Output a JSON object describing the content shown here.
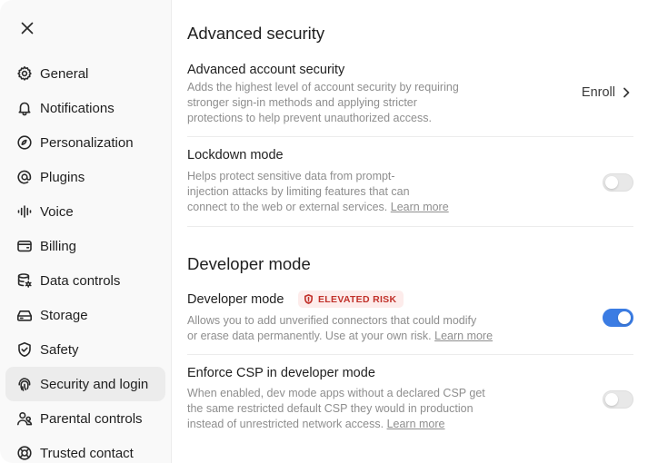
{
  "sidebar": {
    "close_label": "Close",
    "items": [
      {
        "label": "General",
        "icon": "gear-icon"
      },
      {
        "label": "Notifications",
        "icon": "bell-icon"
      },
      {
        "label": "Personalization",
        "icon": "personalization-icon"
      },
      {
        "label": "Plugins",
        "icon": "at-sign-icon"
      },
      {
        "label": "Voice",
        "icon": "waveform-icon"
      },
      {
        "label": "Billing",
        "icon": "wallet-icon"
      },
      {
        "label": "Data controls",
        "icon": "database-settings-icon"
      },
      {
        "label": "Storage",
        "icon": "storage-drive-icon"
      },
      {
        "label": "Safety",
        "icon": "shield-check-icon"
      },
      {
        "label": "Security and login",
        "icon": "fingerprint-icon",
        "active": true
      },
      {
        "label": "Parental controls",
        "icon": "people-icon"
      },
      {
        "label": "Trusted contact",
        "icon": "lifebuoy-icon"
      }
    ]
  },
  "advanced_security": {
    "title": "Advanced security",
    "account": {
      "title": "Advanced account security",
      "desc_lines": [
        "Adds the highest level of account security by requiring",
        "stronger sign-in methods and applying stricter",
        "protections to help prevent unauthorized access."
      ],
      "action_label": "Enroll"
    },
    "lockdown": {
      "title": "Lockdown mode",
      "desc_lines": [
        "Helps protect sensitive data from prompt-",
        "injection attacks by limiting features that can",
        "connect to the web or external services."
      ],
      "link": "Learn more",
      "enabled": false
    }
  },
  "developer": {
    "title": "Developer mode",
    "mode": {
      "title": "Developer mode",
      "badge": "ELEVATED RISK",
      "desc_lines": [
        "Allows you to add unverified connectors that could modify",
        "or erase data permanently. Use at your own risk."
      ],
      "link": "Learn more",
      "enabled": true
    },
    "csp": {
      "title": "Enforce CSP in developer mode",
      "desc_lines": [
        "When enabled, dev mode apps without a declared CSP get",
        "the same restricted default CSP they would in production",
        "instead of unrestricted network access."
      ],
      "link": "Learn more",
      "enabled": false
    }
  },
  "colors": {
    "accent": "#3b7ce3",
    "badge_bg": "#fdeceb",
    "badge_fg": "#c1312a",
    "muted_text": "#8e8e8e",
    "sidebar_bg": "#f9f9f9",
    "active_bg": "#ececec"
  }
}
